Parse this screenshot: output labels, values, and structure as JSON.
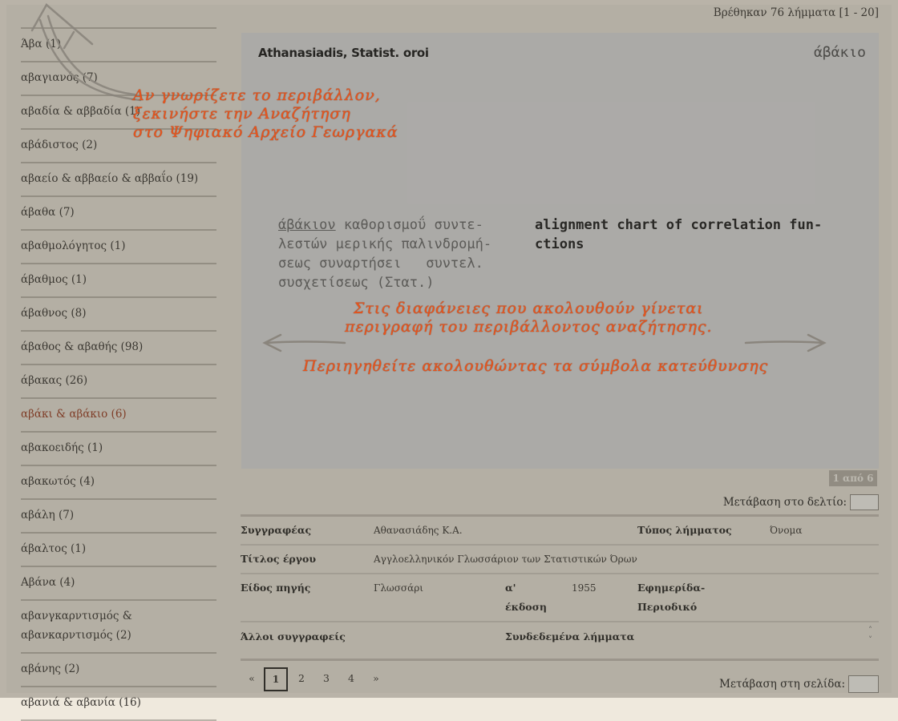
{
  "results_count": "Βρέθηκαν 76 λήμματα [1 - 20]",
  "sidebar": {
    "items": [
      {
        "label": "Άβα (1)",
        "active": false
      },
      {
        "label": "αβαγιανός (7)",
        "active": false
      },
      {
        "label": "αβαδία & αββαδία (1)",
        "active": false
      },
      {
        "label": "αβάδιστος (2)",
        "active": false
      },
      {
        "label": "αβαείο & αββαείο & αββαΐο (19)",
        "active": false
      },
      {
        "label": "άβαθα (7)",
        "active": false
      },
      {
        "label": "αβαθμολόγητος (1)",
        "active": false
      },
      {
        "label": "άβαθμος (1)",
        "active": false
      },
      {
        "label": "άβαθνος (8)",
        "active": false
      },
      {
        "label": "άβαθος & αβαθής (98)",
        "active": false
      },
      {
        "label": "άβακας (26)",
        "active": false
      },
      {
        "label": "αβάκι & αβάκιο (6)",
        "active": true
      },
      {
        "label": "αβακοειδής (1)",
        "active": false
      },
      {
        "label": "αβακωτός (4)",
        "active": false
      },
      {
        "label": "αβάλη (7)",
        "active": false
      },
      {
        "label": "άβαλτος (1)",
        "active": false
      },
      {
        "label": "Αβάνα (4)",
        "active": false
      },
      {
        "label": "αβανγκαρντισμός & αβανκαρντισμός (2)",
        "active": false
      },
      {
        "label": "αβάνης (2)",
        "active": false
      },
      {
        "label": "αβανιά & αβανία (16)",
        "active": false
      }
    ]
  },
  "card": {
    "header_left": "Athanasiadis, Statist. oroi",
    "header_right": "άβάκιο",
    "greek_headword": "άβάκιον",
    "greek_line1_rest": " καθορισμοΰ συντε-",
    "greek_line2": "λεστών μερικής παλινδρομή-",
    "greek_line3": "σεως συναρτήσει   συντελ.",
    "greek_line4": "συσχετίσεως (Στατ.)",
    "english_line1": "alignment chart of correlation fun-",
    "english_line2": "ctions",
    "counter": "1 από 6"
  },
  "goto_card_label": "Μετάβαση στο δελτίο:",
  "metadata": {
    "author_label": "Συγγραφέας",
    "author_value": "Αθανασιάδης Κ.Α.",
    "entry_type_label": "Τύπος λήμματος",
    "entry_type_value": "Όνομα",
    "work_title_label": "Τίτλος έργου",
    "work_title_value": "Αγγλοελληνικόν Γλωσσάριον των Στατιστικών Όρων",
    "source_type_label": "Είδος πηγής",
    "source_type_value": "Γλωσσάρι",
    "edition_label_1": "α'",
    "edition_label_2": "έκδοση",
    "edition_value": "1955",
    "newspaper_label_1": "Εφημερίδα-",
    "newspaper_label_2": "Περιοδικό",
    "other_authors_label": "Άλλοι συγγραφείς",
    "related_label": "Συνδεδεμένα λήμματα"
  },
  "pagination": {
    "prev": "«",
    "pages": [
      "1",
      "2",
      "3",
      "4"
    ],
    "next": "»",
    "current": "1",
    "goto_label": "Μετάβαση στη σελίδα:"
  },
  "overlay_hints": {
    "top_left": "Αν γνωρίζετε το περιβάλλον,\nξεκινήστε την Αναζήτηση\nστο Ψηφιακό Αρχείο Γεωργακά",
    "center": "Στις διαφάνειες που ακολουθούν γίνεται\nπεριγραφή του περιβάλλοντος αναζήτησης.",
    "bottom": "Περιηγηθείτε ακολουθώντας τα σύμβολα κατεύθυνσης"
  },
  "colors": {
    "active_link": "#9c3f25",
    "hint_text": "#e8541c",
    "card_bg": "#dcdcdc"
  }
}
